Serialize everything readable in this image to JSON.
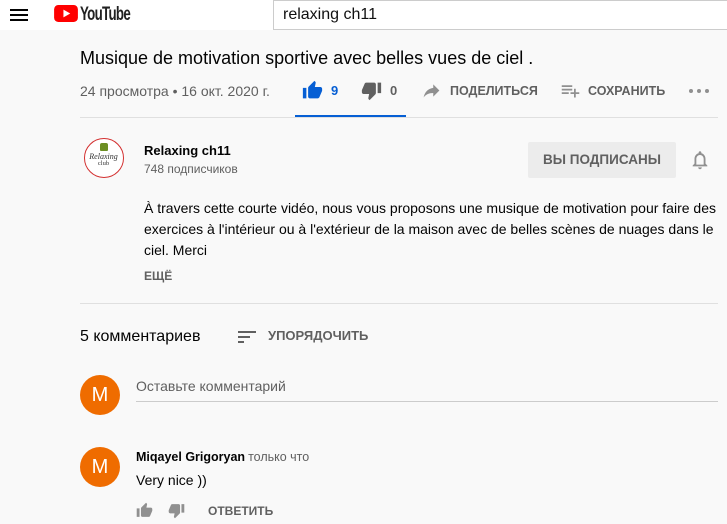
{
  "header": {
    "logo_text": "YouTube",
    "search_value": "relaxing ch11"
  },
  "video": {
    "title": "Musique de motivation sportive avec belles vues de ciel .",
    "meta": "24 просмотра • 16 окт. 2020 г.",
    "likes": "9",
    "dislikes": "0",
    "like_selected": true,
    "share_label": "ПОДЕЛИТЬСЯ",
    "save_label": "СОХРАНИТЬ"
  },
  "channel": {
    "name": "Relaxing ch11",
    "subscribers": "748 подписчиков",
    "subscribe_label": "ВЫ ПОДПИСАНЫ",
    "avatar_logo_lines": [
      "Relaxing",
      "club"
    ]
  },
  "description": {
    "text": "À travers cette courte vidéo, nous vous proposons une musique de motivation pour faire des exercices à l'intérieur ou à l'extérieur de la maison avec de belles scènes de nuages dans le ciel. Merci",
    "more_label": "ЕЩЁ"
  },
  "comments": {
    "count_label": "5 комментариев",
    "sort_label": "УПОРЯДОЧИТЬ",
    "input_placeholder": "Оставьте комментарий",
    "user_avatar_letter": "M",
    "items": [
      {
        "avatar_letter": "M",
        "author": "Miqayel Grigoryan",
        "time": "только что",
        "text": "Very nice ))",
        "reply_label": "ОТВЕТИТЬ"
      }
    ]
  },
  "icons": {
    "menu": "menu-icon",
    "logo": "youtube-logo-icon",
    "like": "thumb-up-icon",
    "dislike": "thumb-down-icon",
    "share": "share-icon",
    "save": "playlist-add-icon",
    "more": "more-horiz-icon",
    "notifications": "bell-icon",
    "sort": "sort-icon"
  },
  "colors": {
    "accent_blue": "#065fd4",
    "brand_red": "#ff0000",
    "avatar_orange": "#ef6c00",
    "background": "#f9f9f9"
  }
}
